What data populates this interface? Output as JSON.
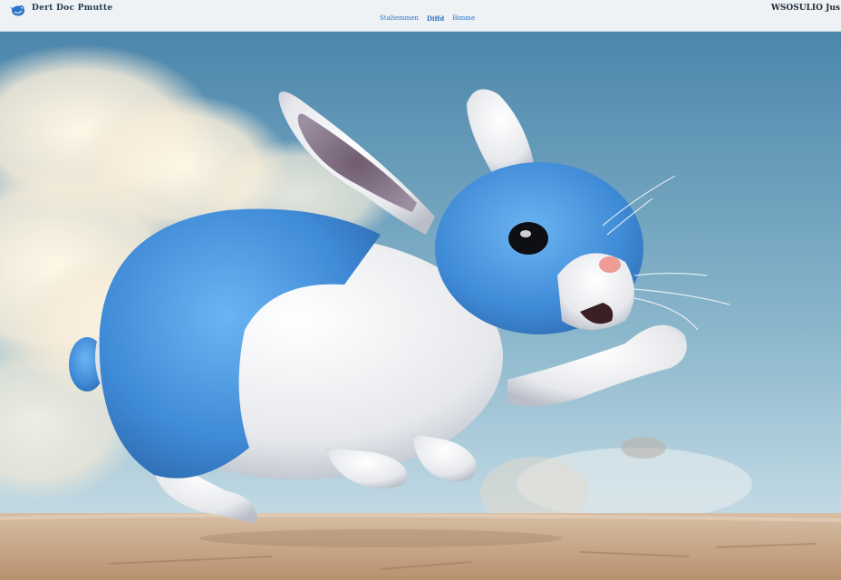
{
  "header": {
    "brand": "Dert Doc Pmutte",
    "nav": [
      {
        "label": "Staltemmen",
        "active": false
      },
      {
        "label": "Diffd",
        "active": true
      },
      {
        "label": "Bimme",
        "active": false
      }
    ],
    "top_right": "WSOSULIO Jus"
  },
  "colors": {
    "accent": "#2a74c8",
    "sky_top": "#4f88ad",
    "sky_bottom": "#cfe1ea",
    "ground": "#c9a789",
    "bunny_blue": "#4d9be0",
    "bunny_white": "#eef0f3"
  },
  "icons": {
    "logo": "bird-logo-icon"
  }
}
